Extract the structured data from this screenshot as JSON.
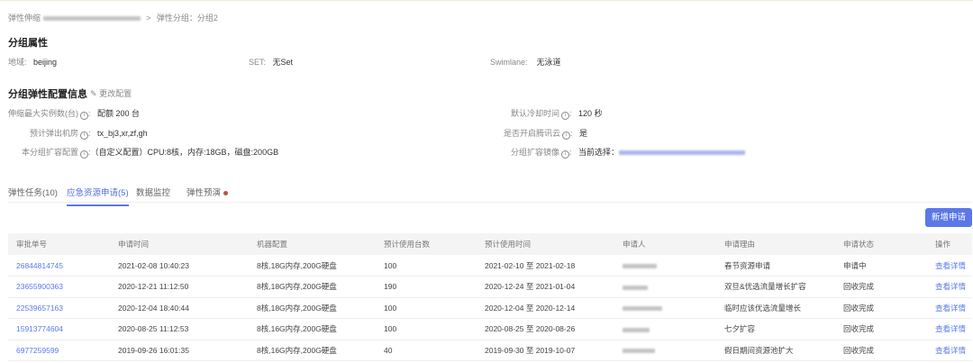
{
  "breadcrumb": {
    "root": "弹性伸缩",
    "sep": ">",
    "current": "弹性分组：分组2"
  },
  "group_attrs": {
    "title": "分组属性",
    "region_label": "地域:",
    "region": "beijing",
    "set_label": "SET:",
    "set": "无Set",
    "swimlane_label": "Swimlane:",
    "swimlane": "无泳道"
  },
  "config": {
    "title": "分组弹性配置信息",
    "edit_label": "更改配置",
    "max_label": "伸缩最大实例数(台)",
    "max_value": "配额 200 台",
    "room_label": "预计弹出机房",
    "room_value": "tx_bj3,xr,zf,gh",
    "spec_label": "本分组扩容配置",
    "spec_value": "（自定义配置）CPU:8核，内存:18GB，磁盘:200GB",
    "cool_label": "默认冷却时间",
    "cool_value": "120 秒",
    "cloud_label": "是否开启腾讯云",
    "cloud_value": "是",
    "image_label": "分组扩容镜像",
    "image_value": "当前选择："
  },
  "tabs": [
    {
      "label": "弹性任务(10)"
    },
    {
      "label": "应急资源申请(5)"
    },
    {
      "label": "数据监控"
    },
    {
      "label": "弹性预演"
    }
  ],
  "add_button": "新增申请",
  "table": {
    "headers": [
      "审批单号",
      "申请时间",
      "机器配置",
      "预计使用台数",
      "预计使用时间",
      "申请人",
      "申请理由",
      "申请状态",
      "操作"
    ],
    "rows": [
      [
        "26844814745",
        "2021-02-08 10:40:23",
        "8核,18G内存,200G硬盘",
        "100",
        "2021-02-10 至 2021-02-18",
        "",
        "春节资源申请",
        "申请中",
        "查看详情"
      ],
      [
        "23655900363",
        "2020-12-21 11:12:50",
        "8核,18G内存,200G硬盘",
        "190",
        "2020-12-24 至 2021-01-04",
        "",
        "双旦&优选流量增长扩容",
        "回收完成",
        "查看详情"
      ],
      [
        "22539657163",
        "2020-12-04 18:40:44",
        "8核,18G内存,200G硬盘",
        "100",
        "2020-12-04 至 2020-12-14",
        "",
        "临时应该优选流量增长",
        "回收完成",
        "查看详情"
      ],
      [
        "15913774604",
        "2020-08-25 11:12:53",
        "8核,16G内存,200G硬盘",
        "100",
        "2020-08-25 至 2020-08-26",
        "",
        "七夕扩容",
        "回收完成",
        "查看详情"
      ],
      [
        "6977259599",
        "2019-09-26 16:01:35",
        "8核,16G内存,200G硬盘",
        "40",
        "2019-09-30 至 2019-10-07",
        "",
        "假日期间资源池扩大",
        "回收完成",
        "查看详情"
      ]
    ]
  }
}
